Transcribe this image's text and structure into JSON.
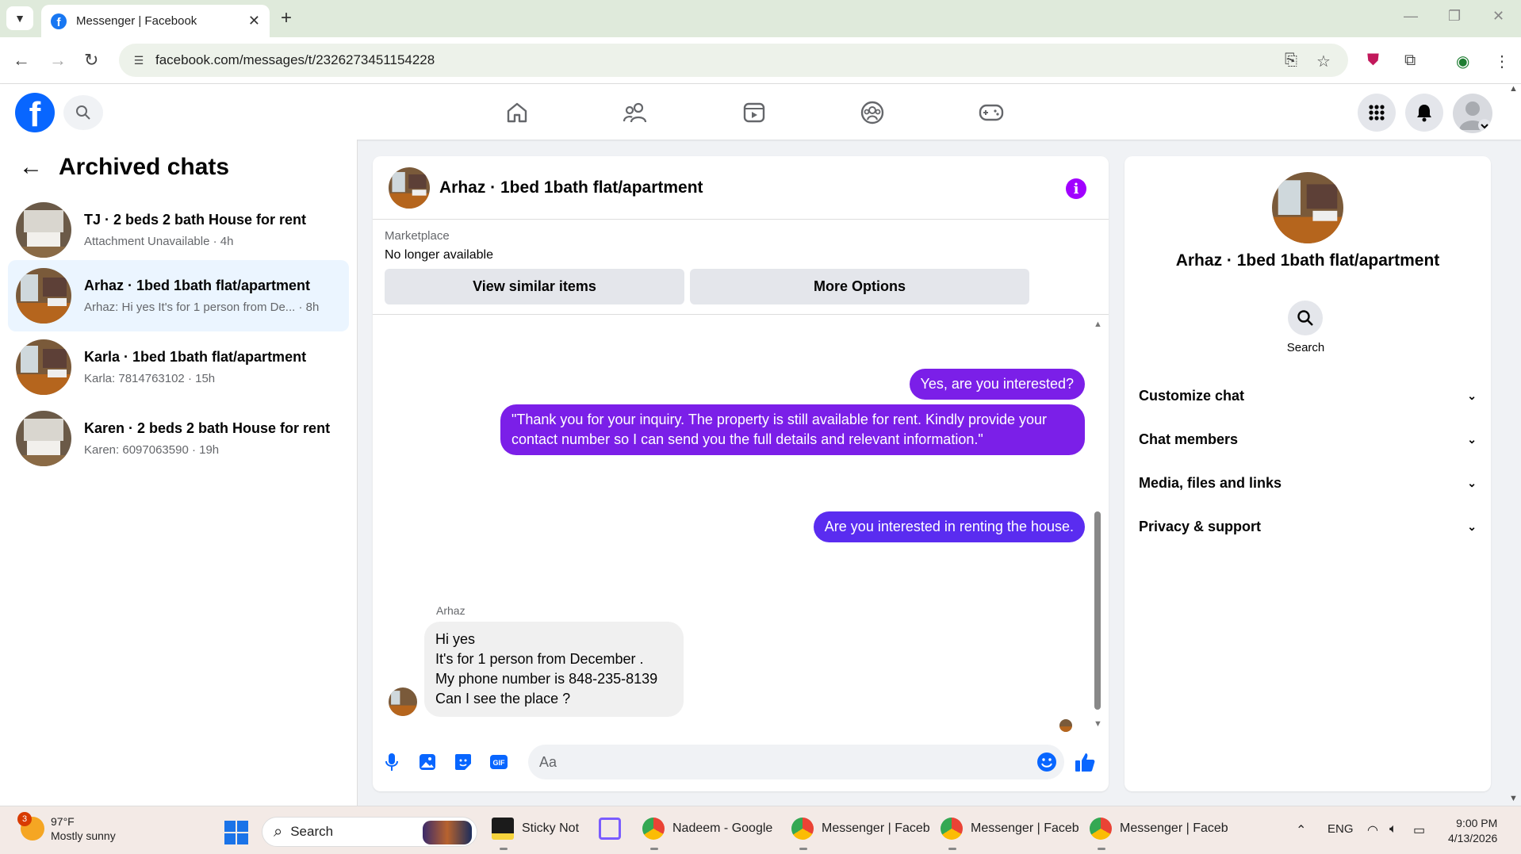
{
  "browser": {
    "tab_title": "Messenger | Facebook",
    "url": "facebook.com/messages/t/2326273451154228"
  },
  "sidebar": {
    "title": "Archived chats",
    "chats": [
      {
        "name": "TJ · 2 beds 2 bath House for rent",
        "subtitle": "Attachment Unavailable · 4h",
        "active": false
      },
      {
        "name": "Arhaz · 1bed 1bath flat/apartment",
        "subtitle": "Arhaz: Hi yes It's for 1 person from De... · 8h",
        "active": true
      },
      {
        "name": "Karla · 1bed 1bath flat/apartment",
        "subtitle": "Karla: 7814763102 · 15h",
        "active": false
      },
      {
        "name": "Karen · 2 beds 2 bath House for rent",
        "subtitle": "Karen: 6097063590 · 19h",
        "active": false
      }
    ]
  },
  "chat": {
    "header_name": "Arhaz · 1bed 1bath flat/apartment",
    "marketplace_label": "Marketplace",
    "marketplace_status": "No longer available",
    "view_similar_label": "View similar items",
    "more_options_label": "More Options",
    "messages": [
      {
        "direction": "out",
        "text": "Yes, are you interested?"
      },
      {
        "direction": "out",
        "text": "\"Thank you for your inquiry. The property is still available for rent. Kindly provide your contact number so I can send you the full details and relevant information.\""
      },
      {
        "direction": "out",
        "text": "Are you interested in renting the house."
      },
      {
        "direction": "in",
        "sender": "Arhaz",
        "lines": [
          "Hi yes",
          "It's for 1 person from December .",
          "My phone number is 848-235-8139",
          "Can I see the place ?"
        ]
      }
    ],
    "composer_placeholder": "Aa"
  },
  "info_panel": {
    "name": "Arhaz · 1bed 1bath flat/apartment",
    "search_label": "Search",
    "sections": [
      "Customize chat",
      "Chat members",
      "Media, files and links",
      "Privacy & support"
    ]
  },
  "taskbar": {
    "weather_temp": "97°F",
    "weather_desc": "Mostly sunny",
    "weather_badge": "3",
    "search_label": "Search",
    "apps": [
      "Sticky Note",
      "Nadeem - Google",
      "Messenger | Faceb",
      "Messenger | Faceb",
      "Messenger | Faceb"
    ],
    "language": "ENG",
    "time": "9:00 PM",
    "date": "4/13/2026"
  },
  "colors": {
    "facebook_blue": "#0866ff",
    "outgoing_bubble": "#7b1fe8",
    "outgoing_bubble_latest": "#5a2cf0",
    "active_chat_bg": "#ebf5ff",
    "info_accent": "#a100ff"
  }
}
